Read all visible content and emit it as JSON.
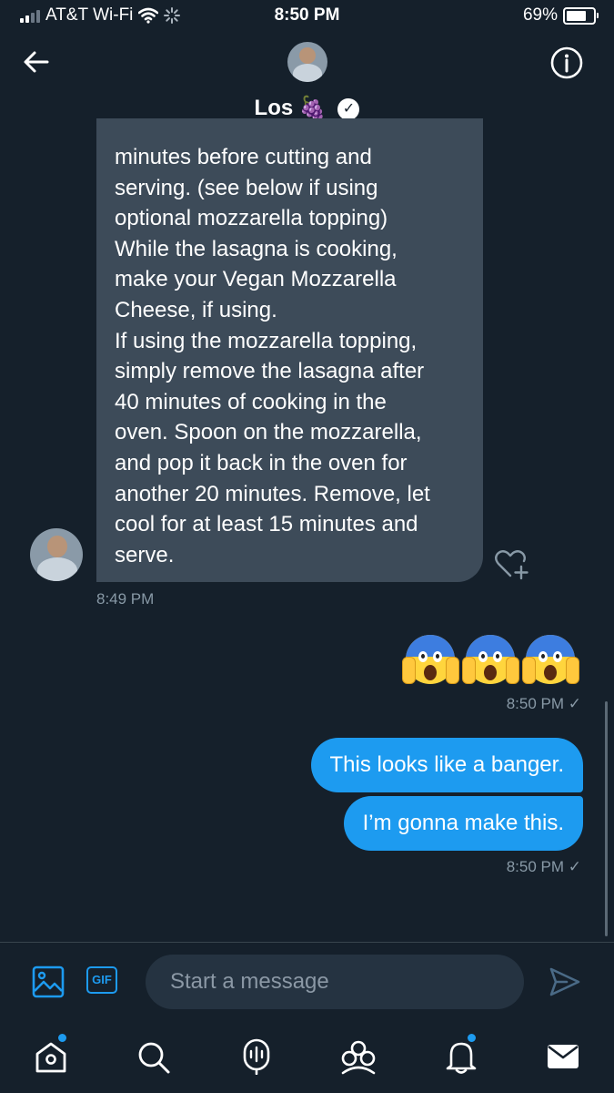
{
  "status_bar": {
    "carrier": "AT&T Wi-Fi",
    "time": "8:50 PM",
    "battery": "69%",
    "battery_level": 0.69
  },
  "header": {
    "name": "Los",
    "name_emoji": "🍇",
    "back_icon": "back-arrow-icon",
    "info_icon": "info-icon",
    "verified_icon": "verified-badge-icon"
  },
  "messages": {
    "incoming": {
      "text": "minutes before cutting and\nserving. (see below if using\noptional mozzarella topping)\nWhile the lasagna is cooking,\nmake your Vegan Mozzarella\nCheese, if using.\nIf using the mozzarella topping,\nsimply remove the lasagna after\n40 minutes of cooking in the\noven. Spoon on the mozzarella,\nand pop it back in the oven for\nanother 20 minutes. Remove, let\ncool for at least 15 minutes and\nserve.",
      "timestamp": "8:49 PM",
      "like_icon": "heart-plus-icon"
    },
    "emoji_message": {
      "emojis": "😱😱😱",
      "timestamp": "8:50 PM ✓"
    },
    "outgoing": [
      {
        "text": "This looks like a banger."
      },
      {
        "text": "I’m gonna make this."
      }
    ],
    "outgoing_timestamp": "8:50 PM ✓"
  },
  "composer": {
    "placeholder": "Start a message",
    "gif_label": "GIF",
    "image_icon": "image-icon",
    "send_icon": "send-icon"
  },
  "nav": {
    "items": [
      "home-icon",
      "search-icon",
      "spaces-icon",
      "communities-icon",
      "notifications-icon",
      "messages-icon"
    ]
  },
  "colors": {
    "background": "#15202b",
    "incoming_bubble": "#3d4b59",
    "outgoing_bubble": "#1d9bf0",
    "accent": "#1d9bf0",
    "muted_text": "#8899a6"
  }
}
